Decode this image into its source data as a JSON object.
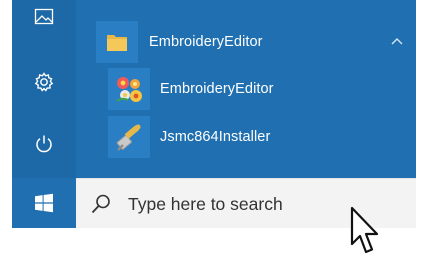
{
  "colors": {
    "rail_bg": "#1d68a6",
    "panel_bg": "#1f6fb1",
    "searchbox_bg": "#f3f3f3",
    "text_light": "#ffffff",
    "text_dark": "#333333"
  },
  "rail": {
    "items": [
      {
        "icon": "pictures-icon"
      },
      {
        "icon": "settings-gear-icon"
      },
      {
        "icon": "power-icon"
      }
    ]
  },
  "app_list": {
    "folder": {
      "icon": "folder-icon",
      "label": "EmbroideryEditor",
      "expand_icon": "chevron-up-icon"
    },
    "items": [
      {
        "icon": "embroidery-editor-app-icon",
        "label": "EmbroideryEditor"
      },
      {
        "icon": "installer-app-icon",
        "label": "Jsmc864Installer"
      }
    ]
  },
  "taskbar": {
    "start_icon": "windows-logo-icon",
    "search": {
      "icon": "search-icon",
      "placeholder": "Type here to search"
    }
  }
}
